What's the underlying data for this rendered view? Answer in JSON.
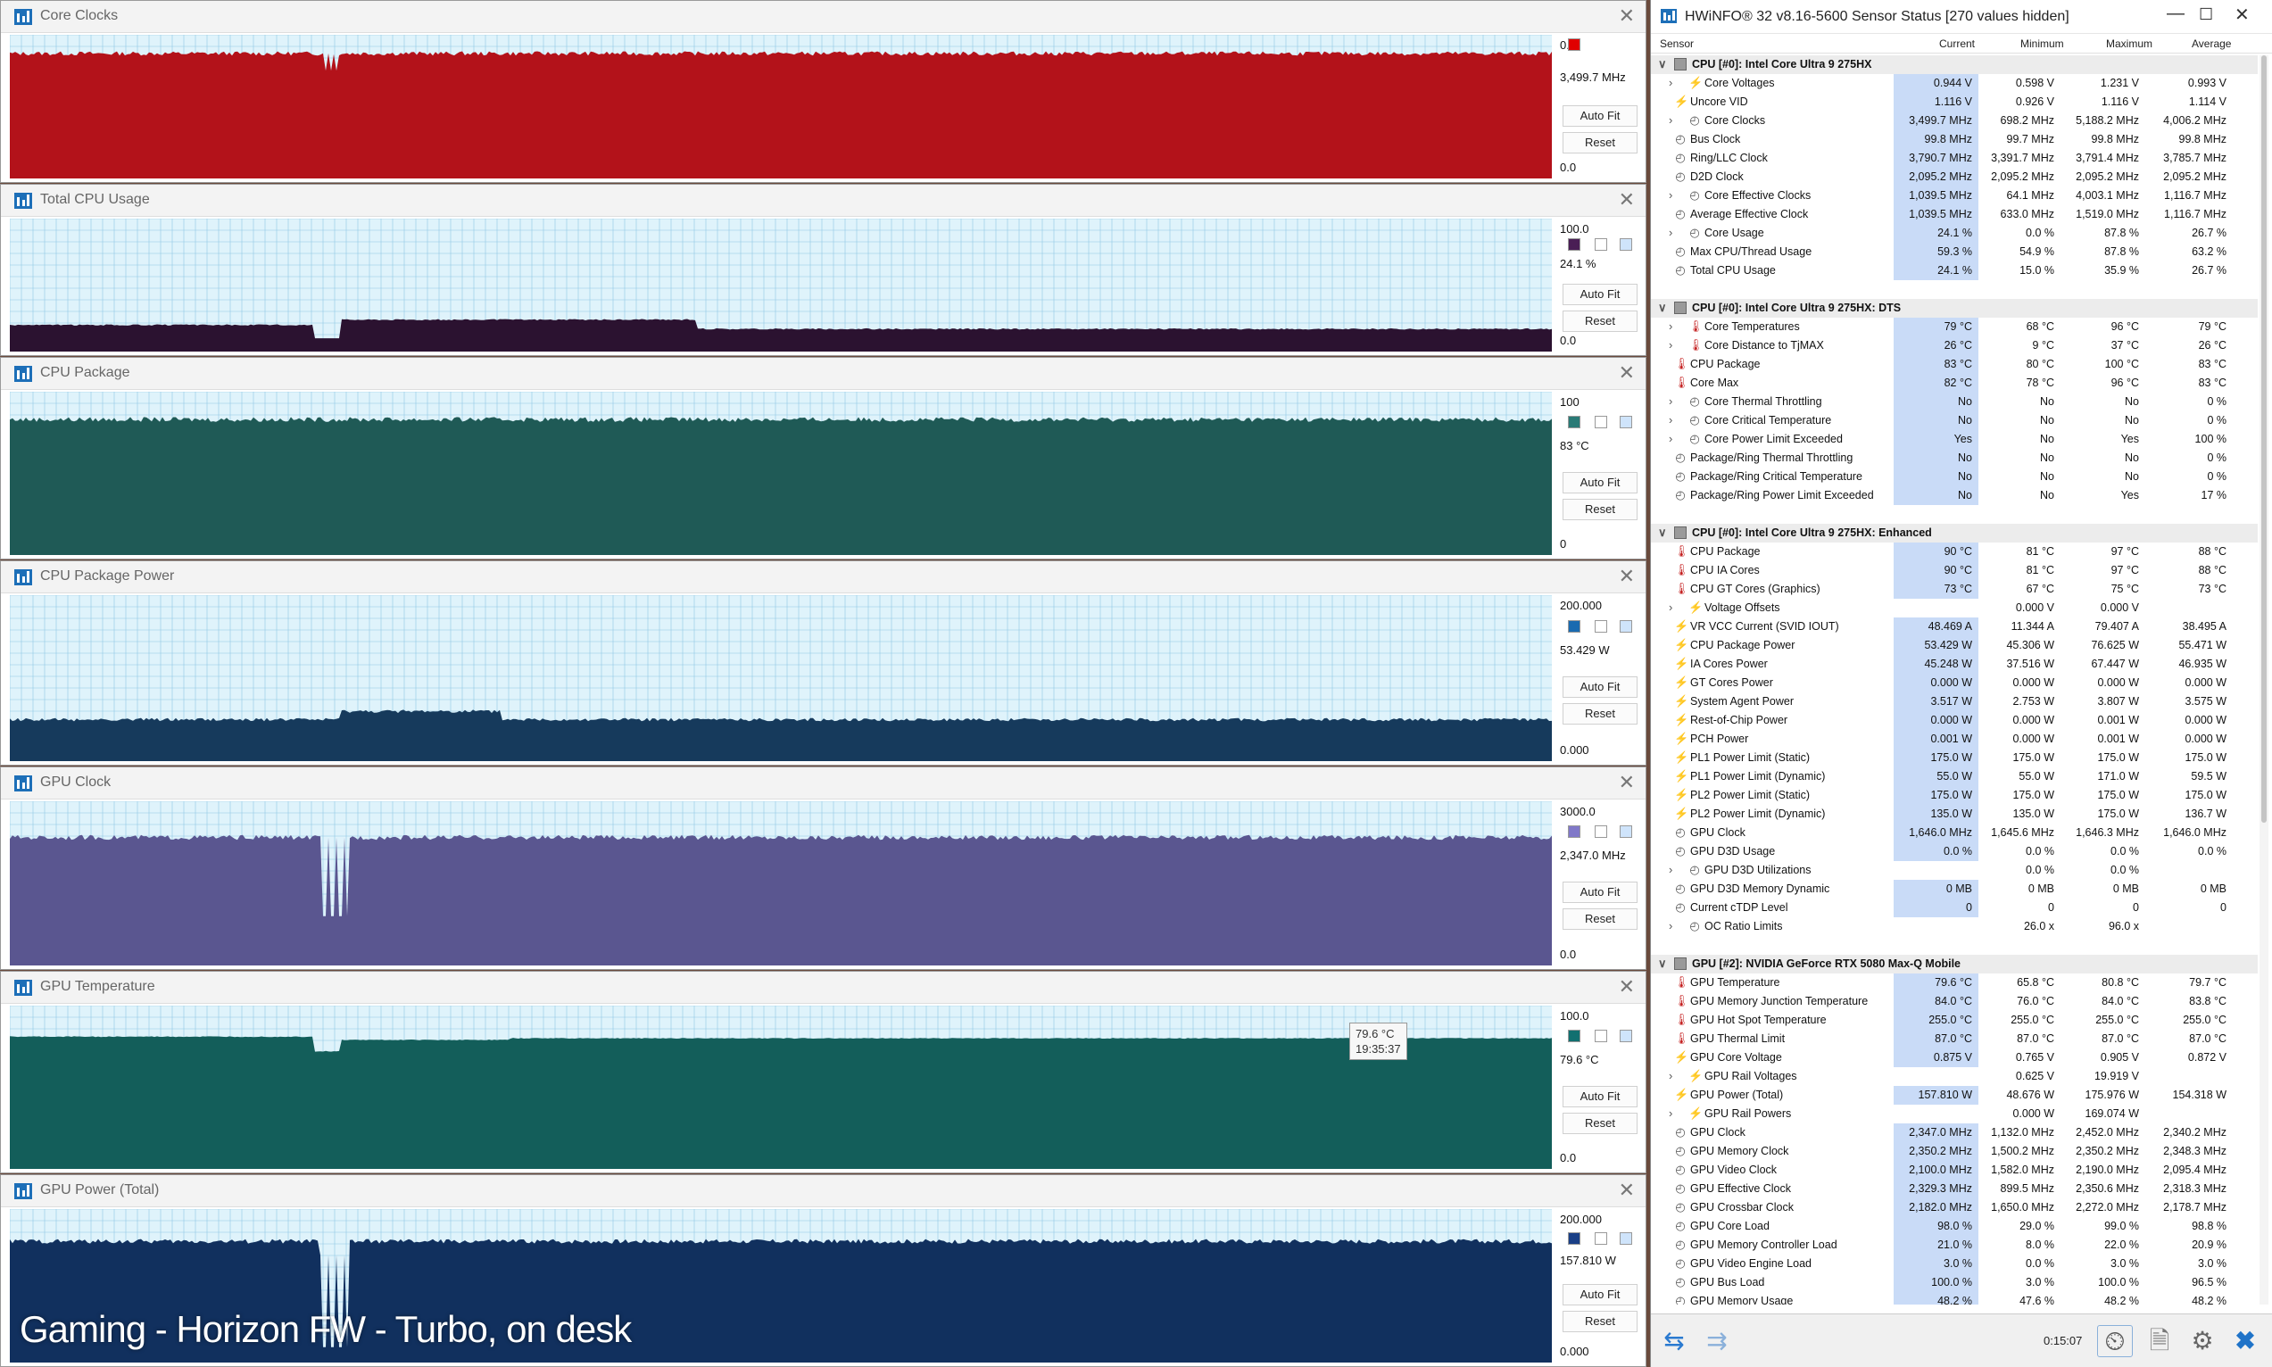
{
  "overlay_caption": "Gaming - Horizon FW - Turbo, on desk",
  "graphs": [
    {
      "title": "Core Clocks",
      "max": "0.0",
      "current": "3,499.7 MHz",
      "min": "0.0",
      "color": "#b3121a",
      "fill_level": 0.87,
      "auto_fit": "Auto Fit",
      "reset": "Reset",
      "square_color": "#e00000"
    },
    {
      "title": "Total CPU Usage",
      "max": "100.0",
      "current": "24.1 %",
      "min": "0.0",
      "color": "#2b1230",
      "fill_level": 0.25,
      "auto_fit": "Auto Fit",
      "reset": "Reset",
      "square_color": "#4a1e55"
    },
    {
      "title": "CPU Package",
      "max": "100",
      "current": "83 °C",
      "min": "0",
      "color": "#1f5a56",
      "fill_level": 0.83,
      "auto_fit": "Auto Fit",
      "reset": "Reset",
      "square_color": "#2a7a76"
    },
    {
      "title": "CPU Package Power",
      "max": "200.000",
      "current": "53.429 W",
      "min": "0.000",
      "color": "#163a5c",
      "fill_level": 0.27,
      "auto_fit": "Auto Fit",
      "reset": "Reset",
      "square_color": "#1a6ab0"
    },
    {
      "title": "GPU Clock",
      "max": "3000.0",
      "current": "2,347.0 MHz",
      "min": "0.0",
      "color": "#5a5690",
      "fill_level": 0.78,
      "auto_fit": "Auto Fit",
      "reset": "Reset",
      "square_color": "#8078c8"
    },
    {
      "title": "GPU Temperature",
      "max": "100.0",
      "current": "79.6 °C",
      "min": "0.0",
      "color": "#135e5a",
      "fill_level": 0.8,
      "auto_fit": "Auto Fit",
      "reset": "Reset",
      "square_color": "#127070"
    },
    {
      "title": "GPU Power (Total)",
      "max": "200.000",
      "current": "157.810 W",
      "min": "0.000",
      "color": "#11305e",
      "fill_level": 0.79,
      "auto_fit": "Auto Fit",
      "reset": "Reset",
      "square_color": "#1a3f86"
    }
  ],
  "tooltip": {
    "value": "79.6 °C",
    "time": "19:35:37"
  },
  "hwinfo": {
    "title": "HWiNFO® 32 v8.16-5600 Sensor Status [270 values hidden]",
    "columns": [
      "Sensor",
      "Current",
      "Minimum",
      "Maximum",
      "Average"
    ],
    "timer": "0:15:07",
    "rows": [
      {
        "t": "h",
        "n": "CPU [#0]: Intel Core Ultra 9 275HX"
      },
      {
        "t": "s",
        "i": "volt",
        "e": 1,
        "n": "Core Voltages",
        "c": "0.944 V",
        "mi": "0.598 V",
        "ma": "1.231 V",
        "av": "0.993 V"
      },
      {
        "t": "s",
        "i": "volt",
        "e": 0,
        "n": "Uncore VID",
        "c": "1.116 V",
        "mi": "0.926 V",
        "ma": "1.116 V",
        "av": "1.114 V"
      },
      {
        "t": "s",
        "i": "clock",
        "e": 1,
        "n": "Core Clocks",
        "c": "3,499.7 MHz",
        "mi": "698.2 MHz",
        "ma": "5,188.2 MHz",
        "av": "4,006.2 MHz"
      },
      {
        "t": "s",
        "i": "clock",
        "e": 0,
        "n": "Bus Clock",
        "c": "99.8 MHz",
        "mi": "99.7 MHz",
        "ma": "99.8 MHz",
        "av": "99.8 MHz"
      },
      {
        "t": "s",
        "i": "clock",
        "e": 0,
        "n": "Ring/LLC Clock",
        "c": "3,790.7 MHz",
        "mi": "3,391.7 MHz",
        "ma": "3,791.4 MHz",
        "av": "3,785.7 MHz"
      },
      {
        "t": "s",
        "i": "clock",
        "e": 0,
        "n": "D2D Clock",
        "c": "2,095.2 MHz",
        "mi": "2,095.2 MHz",
        "ma": "2,095.2 MHz",
        "av": "2,095.2 MHz"
      },
      {
        "t": "s",
        "i": "clock",
        "e": 1,
        "n": "Core Effective Clocks",
        "c": "1,039.5 MHz",
        "mi": "64.1 MHz",
        "ma": "4,003.1 MHz",
        "av": "1,116.7 MHz"
      },
      {
        "t": "s",
        "i": "clock",
        "e": 0,
        "n": "Average Effective Clock",
        "c": "1,039.5 MHz",
        "mi": "633.0 MHz",
        "ma": "1,519.0 MHz",
        "av": "1,116.7 MHz"
      },
      {
        "t": "s",
        "i": "clock",
        "e": 1,
        "n": "Core Usage",
        "c": "24.1 %",
        "mi": "0.0 %",
        "ma": "87.8 %",
        "av": "26.7 %"
      },
      {
        "t": "s",
        "i": "clock",
        "e": 0,
        "n": "Max CPU/Thread Usage",
        "c": "59.3 %",
        "mi": "54.9 %",
        "ma": "87.8 %",
        "av": "63.2 %"
      },
      {
        "t": "s",
        "i": "clock",
        "e": 0,
        "n": "Total CPU Usage",
        "c": "24.1 %",
        "mi": "15.0 %",
        "ma": "35.9 %",
        "av": "26.7 %"
      },
      {
        "t": "b"
      },
      {
        "t": "h",
        "n": "CPU [#0]: Intel Core Ultra 9 275HX: DTS"
      },
      {
        "t": "s",
        "i": "temp",
        "e": 1,
        "n": "Core Temperatures",
        "c": "79 °C",
        "mi": "68 °C",
        "ma": "96 °C",
        "av": "79 °C"
      },
      {
        "t": "s",
        "i": "temp",
        "e": 1,
        "n": "Core Distance to TjMAX",
        "c": "26 °C",
        "mi": "9 °C",
        "ma": "37 °C",
        "av": "26 °C"
      },
      {
        "t": "s",
        "i": "temp",
        "e": 0,
        "n": "CPU Package",
        "c": "83 °C",
        "mi": "80 °C",
        "ma": "100 °C",
        "av": "83 °C"
      },
      {
        "t": "s",
        "i": "temp",
        "e": 0,
        "n": "Core Max",
        "c": "82 °C",
        "mi": "78 °C",
        "ma": "96 °C",
        "av": "83 °C"
      },
      {
        "t": "s",
        "i": "clock",
        "e": 1,
        "n": "Core Thermal Throttling",
        "c": "No",
        "mi": "No",
        "ma": "No",
        "av": "0 %"
      },
      {
        "t": "s",
        "i": "clock",
        "e": 1,
        "n": "Core Critical Temperature",
        "c": "No",
        "mi": "No",
        "ma": "No",
        "av": "0 %"
      },
      {
        "t": "s",
        "i": "clock",
        "e": 1,
        "n": "Core Power Limit Exceeded",
        "c": "Yes",
        "mi": "No",
        "ma": "Yes",
        "av": "100 %"
      },
      {
        "t": "s",
        "i": "clock",
        "e": 0,
        "n": "Package/Ring Thermal Throttling",
        "c": "No",
        "mi": "No",
        "ma": "No",
        "av": "0 %"
      },
      {
        "t": "s",
        "i": "clock",
        "e": 0,
        "n": "Package/Ring Critical Temperature",
        "c": "No",
        "mi": "No",
        "ma": "No",
        "av": "0 %"
      },
      {
        "t": "s",
        "i": "clock",
        "e": 0,
        "n": "Package/Ring Power Limit Exceeded",
        "c": "No",
        "mi": "No",
        "ma": "Yes",
        "av": "17 %"
      },
      {
        "t": "b"
      },
      {
        "t": "h",
        "n": "CPU [#0]: Intel Core Ultra 9 275HX: Enhanced"
      },
      {
        "t": "s",
        "i": "temp",
        "e": 0,
        "n": "CPU Package",
        "c": "90 °C",
        "mi": "81 °C",
        "ma": "97 °C",
        "av": "88 °C"
      },
      {
        "t": "s",
        "i": "temp",
        "e": 0,
        "n": "CPU IA Cores",
        "c": "90 °C",
        "mi": "81 °C",
        "ma": "97 °C",
        "av": "88 °C"
      },
      {
        "t": "s",
        "i": "temp",
        "e": 0,
        "n": "CPU GT Cores (Graphics)",
        "c": "73 °C",
        "mi": "67 °C",
        "ma": "75 °C",
        "av": "73 °C"
      },
      {
        "t": "s",
        "i": "volt",
        "e": 1,
        "n": "Voltage Offsets",
        "c": "",
        "mi": "0.000 V",
        "ma": "0.000 V",
        "av": ""
      },
      {
        "t": "s",
        "i": "volt",
        "e": 0,
        "n": "VR VCC Current (SVID IOUT)",
        "c": "48.469 A",
        "mi": "11.344 A",
        "ma": "79.407 A",
        "av": "38.495 A"
      },
      {
        "t": "s",
        "i": "volt",
        "e": 0,
        "n": "CPU Package Power",
        "c": "53.429 W",
        "mi": "45.306 W",
        "ma": "76.625 W",
        "av": "55.471 W"
      },
      {
        "t": "s",
        "i": "volt",
        "e": 0,
        "n": "IA Cores Power",
        "c": "45.248 W",
        "mi": "37.516 W",
        "ma": "67.447 W",
        "av": "46.935 W"
      },
      {
        "t": "s",
        "i": "volt",
        "e": 0,
        "n": "GT Cores Power",
        "c": "0.000 W",
        "mi": "0.000 W",
        "ma": "0.000 W",
        "av": "0.000 W"
      },
      {
        "t": "s",
        "i": "volt",
        "e": 0,
        "n": "System Agent Power",
        "c": "3.517 W",
        "mi": "2.753 W",
        "ma": "3.807 W",
        "av": "3.575 W"
      },
      {
        "t": "s",
        "i": "volt",
        "e": 0,
        "n": "Rest-of-Chip Power",
        "c": "0.000 W",
        "mi": "0.000 W",
        "ma": "0.001 W",
        "av": "0.000 W"
      },
      {
        "t": "s",
        "i": "volt",
        "e": 0,
        "n": "PCH Power",
        "c": "0.001 W",
        "mi": "0.000 W",
        "ma": "0.001 W",
        "av": "0.000 W"
      },
      {
        "t": "s",
        "i": "volt",
        "e": 0,
        "n": "PL1 Power Limit (Static)",
        "c": "175.0 W",
        "mi": "175.0 W",
        "ma": "175.0 W",
        "av": "175.0 W"
      },
      {
        "t": "s",
        "i": "volt",
        "e": 0,
        "n": "PL1 Power Limit (Dynamic)",
        "c": "55.0 W",
        "mi": "55.0 W",
        "ma": "171.0 W",
        "av": "59.5 W"
      },
      {
        "t": "s",
        "i": "volt",
        "e": 0,
        "n": "PL2 Power Limit (Static)",
        "c": "175.0 W",
        "mi": "175.0 W",
        "ma": "175.0 W",
        "av": "175.0 W"
      },
      {
        "t": "s",
        "i": "volt",
        "e": 0,
        "n": "PL2 Power Limit (Dynamic)",
        "c": "135.0 W",
        "mi": "135.0 W",
        "ma": "175.0 W",
        "av": "136.7 W"
      },
      {
        "t": "s",
        "i": "clock",
        "e": 0,
        "n": "GPU Clock",
        "c": "1,646.0 MHz",
        "mi": "1,645.6 MHz",
        "ma": "1,646.3 MHz",
        "av": "1,646.0 MHz"
      },
      {
        "t": "s",
        "i": "clock",
        "e": 0,
        "n": "GPU D3D Usage",
        "c": "0.0 %",
        "mi": "0.0 %",
        "ma": "0.0 %",
        "av": "0.0 %"
      },
      {
        "t": "s",
        "i": "clock",
        "e": 1,
        "n": "GPU D3D Utilizations",
        "c": "",
        "mi": "0.0 %",
        "ma": "0.0 %",
        "av": ""
      },
      {
        "t": "s",
        "i": "clock",
        "e": 0,
        "n": "GPU D3D Memory Dynamic",
        "c": "0 MB",
        "mi": "0 MB",
        "ma": "0 MB",
        "av": "0 MB"
      },
      {
        "t": "s",
        "i": "clock",
        "e": 0,
        "n": "Current cTDP Level",
        "c": "0",
        "mi": "0",
        "ma": "0",
        "av": "0"
      },
      {
        "t": "s",
        "i": "clock",
        "e": 1,
        "n": "OC Ratio Limits",
        "c": "",
        "mi": "26.0 x",
        "ma": "96.0 x",
        "av": ""
      },
      {
        "t": "b"
      },
      {
        "t": "h",
        "n": "GPU [#2]: NVIDIA  GeForce RTX 5080 Max-Q Mobile"
      },
      {
        "t": "s",
        "i": "temp",
        "e": 0,
        "n": "GPU Temperature",
        "c": "79.6 °C",
        "mi": "65.8 °C",
        "ma": "80.8 °C",
        "av": "79.7 °C"
      },
      {
        "t": "s",
        "i": "temp",
        "e": 0,
        "n": "GPU Memory Junction Temperature",
        "c": "84.0 °C",
        "mi": "76.0 °C",
        "ma": "84.0 °C",
        "av": "83.8 °C"
      },
      {
        "t": "s",
        "i": "temp",
        "e": 0,
        "n": "GPU Hot Spot Temperature",
        "c": "255.0 °C",
        "mi": "255.0 °C",
        "ma": "255.0 °C",
        "av": "255.0 °C"
      },
      {
        "t": "s",
        "i": "temp",
        "e": 0,
        "n": "GPU Thermal Limit",
        "c": "87.0 °C",
        "mi": "87.0 °C",
        "ma": "87.0 °C",
        "av": "87.0 °C"
      },
      {
        "t": "s",
        "i": "volt",
        "e": 0,
        "n": "GPU Core Voltage",
        "c": "0.875 V",
        "mi": "0.765 V",
        "ma": "0.905 V",
        "av": "0.872 V"
      },
      {
        "t": "s",
        "i": "volt",
        "e": 1,
        "n": "GPU Rail Voltages",
        "c": "",
        "mi": "0.625 V",
        "ma": "19.919 V",
        "av": ""
      },
      {
        "t": "s",
        "i": "volt",
        "e": 0,
        "n": "GPU Power (Total)",
        "c": "157.810 W",
        "mi": "48.676 W",
        "ma": "175.976 W",
        "av": "154.318 W"
      },
      {
        "t": "s",
        "i": "volt",
        "e": 1,
        "n": "GPU Rail Powers",
        "c": "",
        "mi": "0.000 W",
        "ma": "169.074 W",
        "av": ""
      },
      {
        "t": "s",
        "i": "clock",
        "e": 0,
        "n": "GPU Clock",
        "c": "2,347.0 MHz",
        "mi": "1,132.0 MHz",
        "ma": "2,452.0 MHz",
        "av": "2,340.2 MHz"
      },
      {
        "t": "s",
        "i": "clock",
        "e": 0,
        "n": "GPU Memory Clock",
        "c": "2,350.2 MHz",
        "mi": "1,500.2 MHz",
        "ma": "2,350.2 MHz",
        "av": "2,348.3 MHz"
      },
      {
        "t": "s",
        "i": "clock",
        "e": 0,
        "n": "GPU Video Clock",
        "c": "2,100.0 MHz",
        "mi": "1,582.0 MHz",
        "ma": "2,190.0 MHz",
        "av": "2,095.4 MHz"
      },
      {
        "t": "s",
        "i": "clock",
        "e": 0,
        "n": "GPU Effective Clock",
        "c": "2,329.3 MHz",
        "mi": "899.5 MHz",
        "ma": "2,350.6 MHz",
        "av": "2,318.3 MHz"
      },
      {
        "t": "s",
        "i": "clock",
        "e": 0,
        "n": "GPU Crossbar Clock",
        "c": "2,182.0 MHz",
        "mi": "1,650.0 MHz",
        "ma": "2,272.0 MHz",
        "av": "2,178.7 MHz"
      },
      {
        "t": "s",
        "i": "clock",
        "e": 0,
        "n": "GPU Core Load",
        "c": "98.0 %",
        "mi": "29.0 %",
        "ma": "99.0 %",
        "av": "98.8 %"
      },
      {
        "t": "s",
        "i": "clock",
        "e": 0,
        "n": "GPU Memory Controller Load",
        "c": "21.0 %",
        "mi": "8.0 %",
        "ma": "22.0 %",
        "av": "20.9 %"
      },
      {
        "t": "s",
        "i": "clock",
        "e": 0,
        "n": "GPU Video Engine Load",
        "c": "3.0 %",
        "mi": "0.0 %",
        "ma": "3.0 %",
        "av": "3.0 %"
      },
      {
        "t": "s",
        "i": "clock",
        "e": 0,
        "n": "GPU Bus Load",
        "c": "100.0 %",
        "mi": "3.0 %",
        "ma": "100.0 %",
        "av": "96.5 %"
      },
      {
        "t": "s",
        "i": "clock",
        "e": 0,
        "n": "GPU Memory Usage",
        "c": "48.2 %",
        "mi": "47.6 %",
        "ma": "48.2 %",
        "av": "48.2 %"
      }
    ]
  }
}
